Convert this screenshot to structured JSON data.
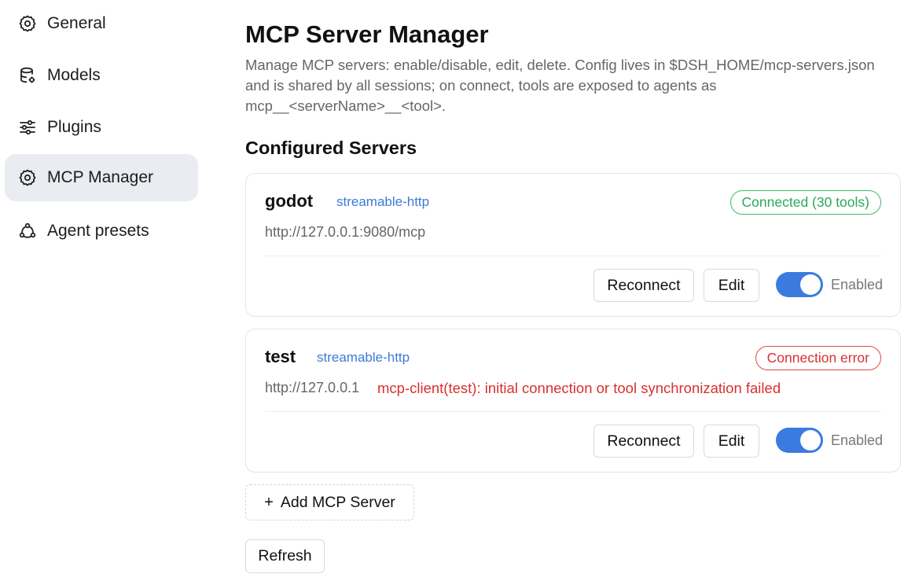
{
  "sidebar": {
    "items": [
      {
        "label": "General",
        "icon": "gear-icon"
      },
      {
        "label": "Models",
        "icon": "database-icon"
      },
      {
        "label": "Plugins",
        "icon": "sliders-icon"
      },
      {
        "label": "MCP Manager",
        "icon": "gear-icon",
        "active": true
      },
      {
        "label": "Agent presets",
        "icon": "agent-presets-icon"
      }
    ]
  },
  "main": {
    "title": "MCP Server Manager",
    "description": "Manage MCP servers: enable/disable, edit, delete. Config lives in $DSH_HOME/mcp-servers.json and is shared by all sessions; on connect, tools are exposed to agents as mcp__<serverName>__<tool>.",
    "section_title": "Configured Servers",
    "servers": [
      {
        "name": "godot",
        "transport": "streamable-http",
        "status": "Connected (30 tools)",
        "status_kind": "ok",
        "url": "http://127.0.0.1:9080/mcp",
        "error": "",
        "reconnect_label": "Reconnect",
        "edit_label": "Edit",
        "enabled": true,
        "enabled_label": "Enabled"
      },
      {
        "name": "test",
        "transport": "streamable-http",
        "status": "Connection error",
        "status_kind": "error",
        "url": "http://127.0.0.1",
        "error": "mcp-client(test): initial connection or tool synchronization failed",
        "reconnect_label": "Reconnect",
        "edit_label": "Edit",
        "enabled": true,
        "enabled_label": "Enabled"
      }
    ],
    "add_button_icon": "+",
    "add_button_label": "Add MCP Server",
    "refresh_label": "Refresh"
  },
  "colors": {
    "accent": "#3b7be0",
    "link": "#3d7bd4",
    "success": "#2aa85a",
    "error": "#d93030",
    "active_nav_bg": "#e9ecf0"
  }
}
